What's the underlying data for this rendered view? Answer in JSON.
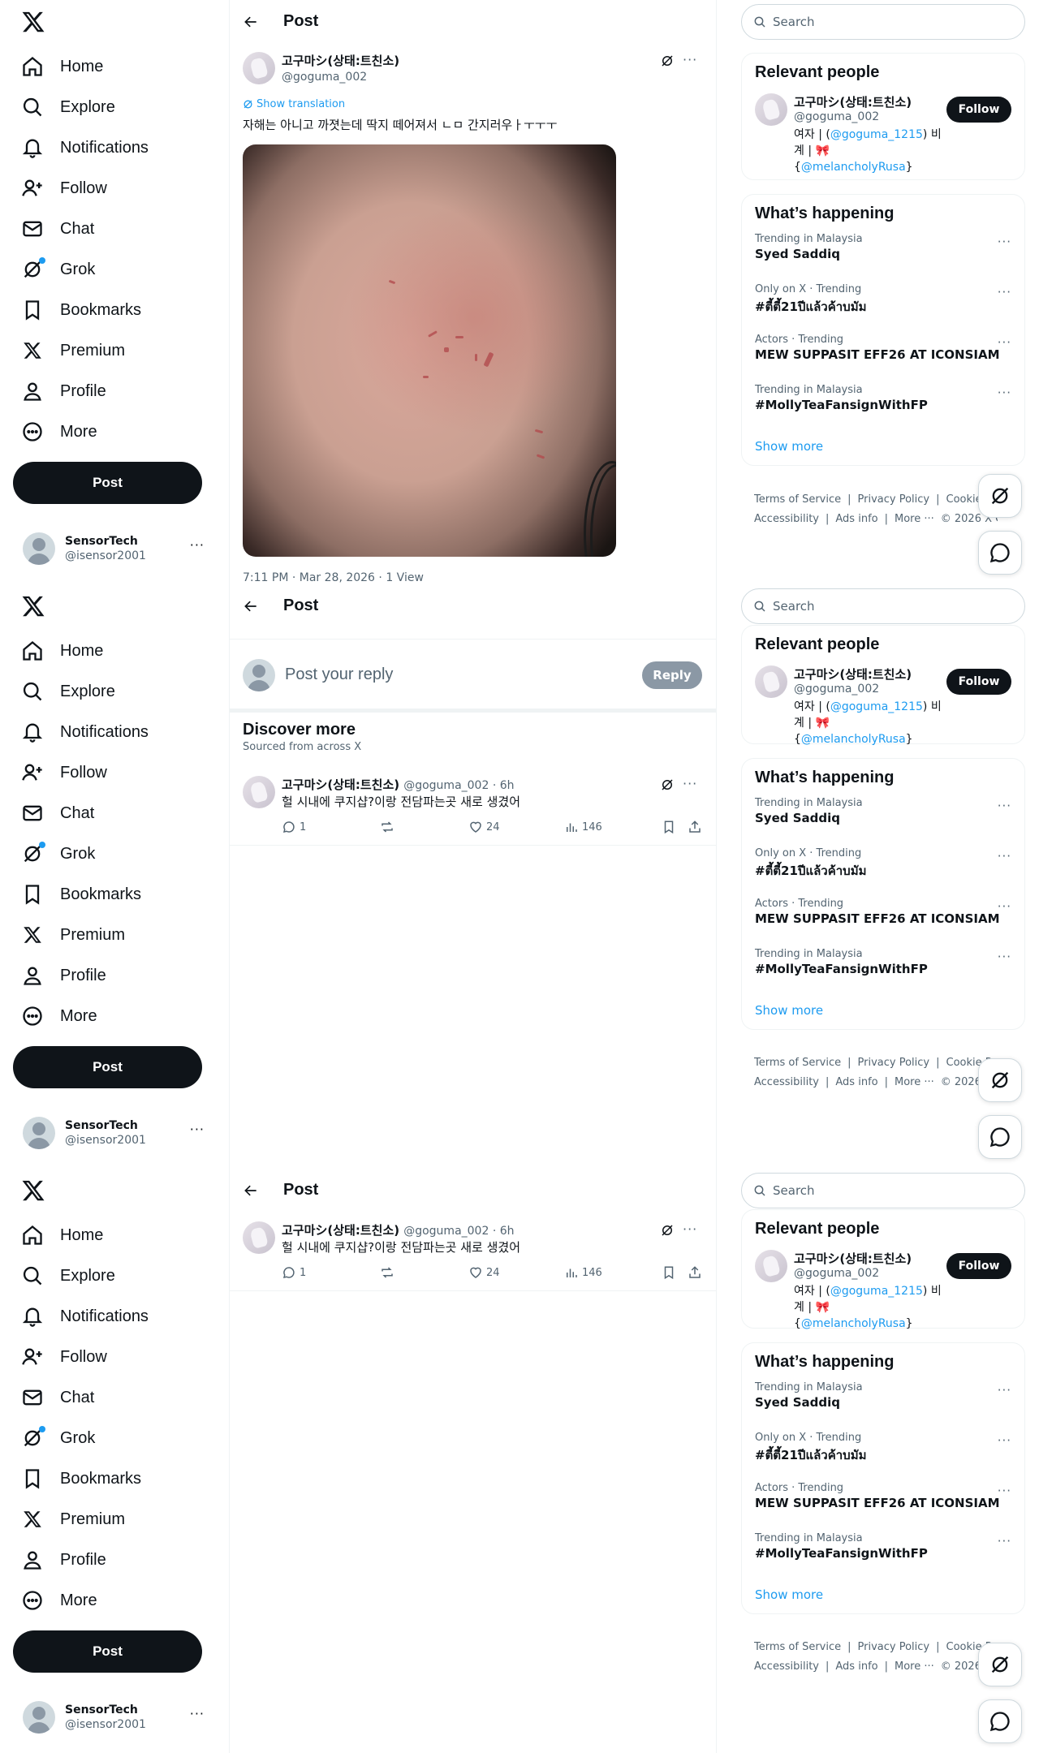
{
  "nav": {
    "items": [
      {
        "label": "Home",
        "icon": "home-icon"
      },
      {
        "label": "Explore",
        "icon": "search-icon"
      },
      {
        "label": "Notifications",
        "icon": "bell-icon"
      },
      {
        "label": "Follow",
        "icon": "person-add-icon"
      },
      {
        "label": "Chat",
        "icon": "envelope-icon"
      },
      {
        "label": "Grok",
        "icon": "grok-icon"
      },
      {
        "label": "Bookmarks",
        "icon": "bookmark-icon"
      },
      {
        "label": "Premium",
        "icon": "x-logo-icon"
      },
      {
        "label": "Profile",
        "icon": "person-icon"
      },
      {
        "label": "More",
        "icon": "more-circle-icon"
      }
    ],
    "post_button": "Post",
    "account": {
      "display_name": "SensorTech",
      "handle": "@isensor2001",
      "more": "···"
    }
  },
  "header": {
    "title": "Post"
  },
  "tweet": {
    "display_name": "고구마シ(상태:트친소)",
    "handle": "@goguma_002",
    "show_translation": "Show translation",
    "text": "자해는 아니고 까졋는데 딱지 떼어져서 ㄴㅁ 간지러우ㅏㅜㅜㅜ",
    "meta": "7:11 PM · Mar 28, 2026 · 1 View"
  },
  "reply": {
    "placeholder": "Post your reply",
    "button": "Reply"
  },
  "discover": {
    "title": "Discover more",
    "subtitle": "Sourced from across X"
  },
  "related_tweet": {
    "display_name": "고구마シ(상태:트친소)",
    "handle_time": "@goguma_002 · 6h",
    "text": "헐 시내에 쿠지샵?이랑 전담파는곳 새로 생겼어",
    "replies": "1",
    "likes": "24",
    "views": "146"
  },
  "search": {
    "placeholder": "Search"
  },
  "relevant": {
    "title": "Relevant people",
    "display_name": "고구마シ(상태:트친소)",
    "handle": "@goguma_002",
    "bio_prefix": "여자 | (",
    "bio_link1": "@goguma_1215",
    "bio_mid": ") 비계 | 🎀 {",
    "bio_link2": "@melancholyRusa",
    "bio_suffix": "}",
    "follow": "Follow"
  },
  "happening": {
    "title": "What’s happening",
    "trends": [
      {
        "context": "Trending in Malaysia",
        "name": "Syed Saddiq"
      },
      {
        "context": "Only on X · Trending",
        "name": "#ตี้ตี้21ปีแล้วค้าบมัม"
      },
      {
        "context": "Actors · Trending",
        "name": "MEW SUPPASIT EFF26 AT ICONSIAM"
      },
      {
        "context": "Trending in Malaysia",
        "name": "#MollyTeaFansignWithFP"
      }
    ],
    "show_more": "Show more",
    "trend_more": "···"
  },
  "footer": {
    "links_row1": [
      "Terms of Service",
      "|",
      "Privacy Policy",
      "|",
      "Cookie Policy",
      "|"
    ],
    "links_row2": [
      "Accessibility",
      "|",
      "Ads info",
      "|",
      "More ···",
      "© 2026 X Corp."
    ]
  },
  "colors": {
    "accent": "#1d9bf0",
    "text": "#0f1419",
    "muted": "#536471",
    "border": "#eff3f4"
  }
}
